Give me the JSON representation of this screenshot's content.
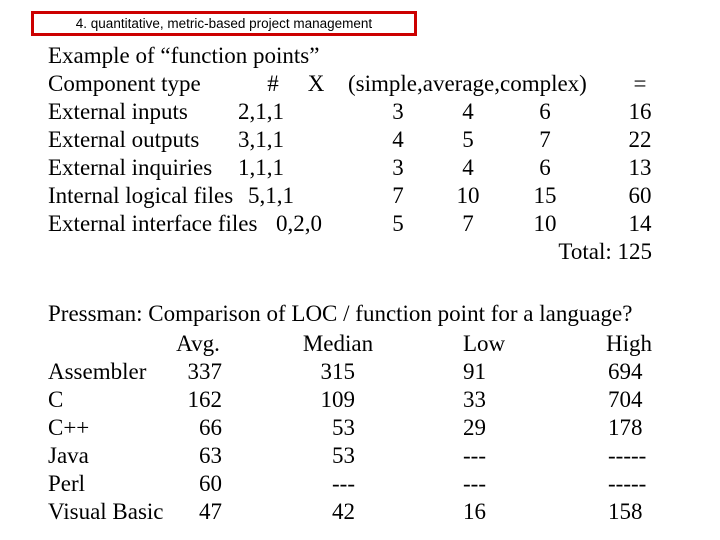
{
  "slide": {
    "title": "4. quantitative, metric-based project management",
    "title_border_color": "#cc0000",
    "example_heading": "Example of “function points”"
  },
  "function_points": {
    "header": {
      "label": "Component type",
      "count": "#",
      "multiply": "X",
      "weights": "(simple,average,complex)",
      "equals": "=",
      "simple": "",
      "average": "",
      "complex": "",
      "result": ""
    },
    "rows": [
      {
        "label": "External inputs",
        "count": "2,1,1",
        "simple": "3",
        "average": "4",
        "complex": "6",
        "result": "16"
      },
      {
        "label": "External outputs",
        "count": "3,1,1",
        "simple": "4",
        "average": "5",
        "complex": "7",
        "result": "22"
      },
      {
        "label": "External inquiries",
        "count": "1,1,1",
        "simple": "3",
        "average": "4",
        "complex": "6",
        "result": "13"
      },
      {
        "label": "Internal logical files",
        "count": "5,1,1",
        "simple": "7",
        "average": "10",
        "complex": "15",
        "result": "60"
      },
      {
        "label": "External interface files",
        "count": "0,2,0",
        "simple": "5",
        "average": "7",
        "complex": "10",
        "result": "14"
      }
    ],
    "total_label": "Total: 125"
  },
  "language_table": {
    "heading": "Pressman: Comparison of LOC / function point for a language?",
    "columns": {
      "name": "",
      "avg": "Avg.",
      "median": "Median",
      "low": "Low",
      "high": "High"
    },
    "rows": [
      {
        "name": "Assembler",
        "avg": "337",
        "median": "315",
        "low": "91",
        "high": "694"
      },
      {
        "name": "C",
        "avg": "162",
        "median": "109",
        "low": "33",
        "high": "704"
      },
      {
        "name": "C++",
        "avg": "66",
        "median": "53",
        "low": "29",
        "high": "178"
      },
      {
        "name": "Java",
        "avg": "63",
        "median": "53",
        "low": "---",
        "high": "-----"
      },
      {
        "name": "Perl",
        "avg": "60",
        "median": "---",
        "low": "---",
        "high": "-----"
      },
      {
        "name": "Visual Basic",
        "avg": "47",
        "median": "42",
        "low": "16",
        "high": "158"
      }
    ]
  }
}
